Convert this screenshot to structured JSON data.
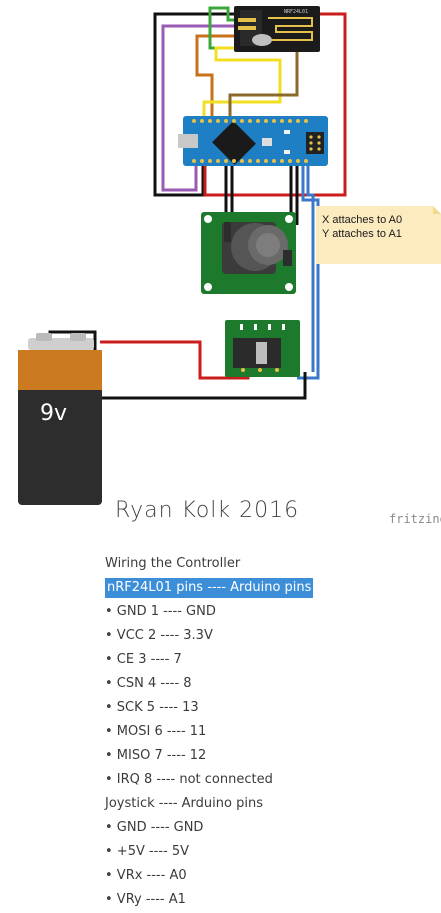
{
  "diagram": {
    "note_lines": [
      "X attaches to A0",
      "Y attaches to A1"
    ],
    "battery_label": "9v",
    "author": "Ryan Kolk 2016",
    "watermark": "fritzing",
    "module_text": "NRF24L01",
    "colors": {
      "board_blue": "#1f7fc4",
      "pcb_green": "#1d7a2c",
      "wire_red": "#cc1b1b",
      "wire_black": "#111111",
      "wire_blue": "#3a78c9",
      "wire_purple": "#9b59b6",
      "wire_orange": "#c8711b",
      "wire_green": "#3aa83a",
      "wire_yellow": "#f0e020",
      "wire_brown": "#8a6a2a",
      "note_bg": "#fdebc0",
      "battery_orange": "#cc7a22",
      "battery_dark": "#2d2d2d"
    }
  },
  "pins": {
    "heading": "Wiring the Controller",
    "nrf_header": "nRF24L01 pins ---- Arduino pins",
    "nrf_items": [
      "• GND 1 ---- GND",
      "• VCC 2 ---- 3.3V",
      "• CE 3 ---- 7",
      "• CSN 4 ---- 8",
      "• SCK 5 ---- 13",
      "• MOSI 6 ---- 11",
      "• MISO 7 ---- 12",
      "• IRQ 8 ---- not connected"
    ],
    "joystick_header": "Joystick ---- Arduino pins",
    "joystick_items": [
      "• GND ---- GND",
      "• +5V ---- 5V",
      "• VRx ---- A0",
      "• VRy ---- A1"
    ]
  }
}
